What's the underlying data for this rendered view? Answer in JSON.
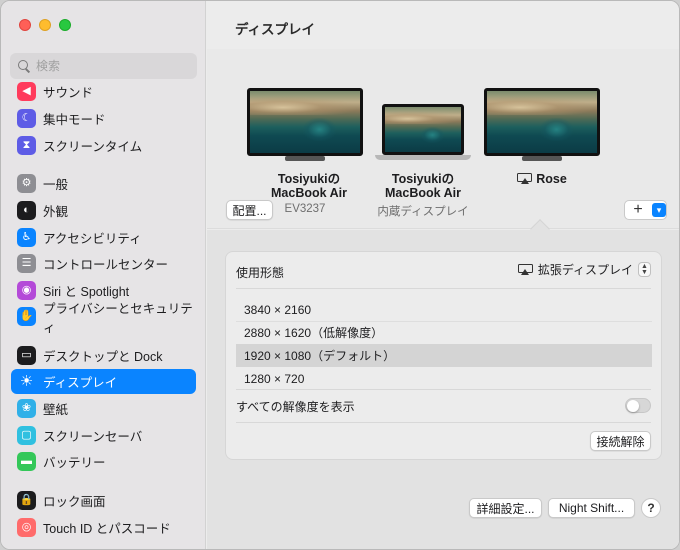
{
  "sidebar": {
    "search_placeholder": "検索",
    "items": [
      {
        "label": "サウンド",
        "icon": "speaker-icon",
        "color": "#ff3b5c",
        "glyph": "◀"
      },
      {
        "label": "集中モード",
        "icon": "moon-icon",
        "color": "#5e5ce6",
        "glyph": "☾"
      },
      {
        "label": "スクリーンタイム",
        "icon": "hourglass-icon",
        "color": "#5e5ce6",
        "glyph": "⧗"
      },
      {
        "label": "一般",
        "icon": "gear-icon",
        "color": "#8e8e93",
        "glyph": "⚙"
      },
      {
        "label": "外観",
        "icon": "appearance-icon",
        "color": "#1c1c1e",
        "glyph": "◐"
      },
      {
        "label": "アクセシビリティ",
        "icon": "accessibility-icon",
        "color": "#0a84ff",
        "glyph": "♿"
      },
      {
        "label": "コントロールセンター",
        "icon": "control-center-icon",
        "color": "#8e8e93",
        "glyph": "☰"
      },
      {
        "label": "Siri と Spotlight",
        "icon": "siri-icon",
        "color": "#b44ad8",
        "glyph": "◉"
      },
      {
        "label": "プライバシーとセキュリティ",
        "icon": "hand-icon",
        "color": "#0a84ff",
        "glyph": "✋"
      },
      {
        "label": "デスクトップと Dock",
        "icon": "dock-icon",
        "color": "#1c1c1e",
        "glyph": "▭"
      },
      {
        "label": "ディスプレイ",
        "icon": "sun-icon",
        "color": "#0a84ff",
        "glyph": "☀",
        "selected": true
      },
      {
        "label": "壁紙",
        "icon": "wallpaper-icon",
        "color": "#30b0e8",
        "glyph": "❀"
      },
      {
        "label": "スクリーンセーバ",
        "icon": "screensaver-icon",
        "color": "#30c0e0",
        "glyph": "▢"
      },
      {
        "label": "バッテリー",
        "icon": "battery-icon",
        "color": "#34c759",
        "glyph": "▬"
      },
      {
        "label": "ロック画面",
        "icon": "lock-icon",
        "color": "#1c1c1e",
        "glyph": "🔒"
      },
      {
        "label": "Touch ID とパスコード",
        "icon": "fingerprint-icon",
        "color": "#ff6b6b",
        "glyph": "◎"
      }
    ]
  },
  "main": {
    "title": "ディスプレイ",
    "arrange_button": "配置...",
    "displays": [
      {
        "name_line1": "Tosiyukiの",
        "name_line2": "MacBook Air",
        "sub": "EV3237"
      },
      {
        "name_line1": "Tosiyukiの",
        "name_line2": "MacBook Air",
        "sub": "内蔵ディスプレイ"
      },
      {
        "name": "Rose"
      }
    ],
    "add_button": "+",
    "usage_label": "使用形態",
    "usage_value": "拡張ディスプレイ",
    "resolutions": [
      {
        "label": "3840 × 2160"
      },
      {
        "label": "2880 × 1620（低解像度）"
      },
      {
        "label": "1920 × 1080（デフォルト）",
        "selected": true
      },
      {
        "label": "1280 × 720"
      }
    ],
    "show_all_label": "すべての解像度を表示",
    "show_all_on": false,
    "disconnect_button": "接続解除",
    "advanced_button": "詳細設定...",
    "night_shift_button": "Night Shift...",
    "help_button": "?"
  }
}
